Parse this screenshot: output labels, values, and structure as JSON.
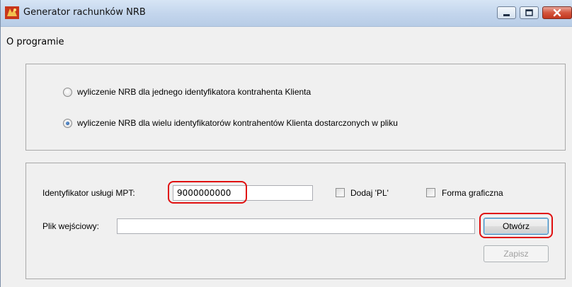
{
  "window": {
    "title": "Generator rachunków NRB"
  },
  "menu": {
    "items": [
      "O programie"
    ]
  },
  "mode_group": {
    "options": [
      {
        "label": "wyliczenie NRB dla jednego identyfikatora kontrahenta Klienta",
        "selected": false
      },
      {
        "label": "wyliczenie NRB dla wielu identyfikatorów kontrahentów Klienta dostarczonych w pliku",
        "selected": true
      }
    ]
  },
  "form": {
    "service_id_label": "Identyfikator usługi MPT:",
    "service_id_value": "9000000000",
    "add_pl_label": "Dodaj 'PL'",
    "add_pl_checked": false,
    "graphic_form_label": "Forma graficzna",
    "graphic_form_checked": false,
    "input_file_label": "Plik wejściowy:",
    "input_file_value": "",
    "open_button": "Otwórz",
    "save_button": "Zapisz",
    "save_enabled": false
  },
  "colors": {
    "highlight": "#e01010",
    "titlebar": "#c4d6ed",
    "radio_selected": "#1d4f96"
  }
}
